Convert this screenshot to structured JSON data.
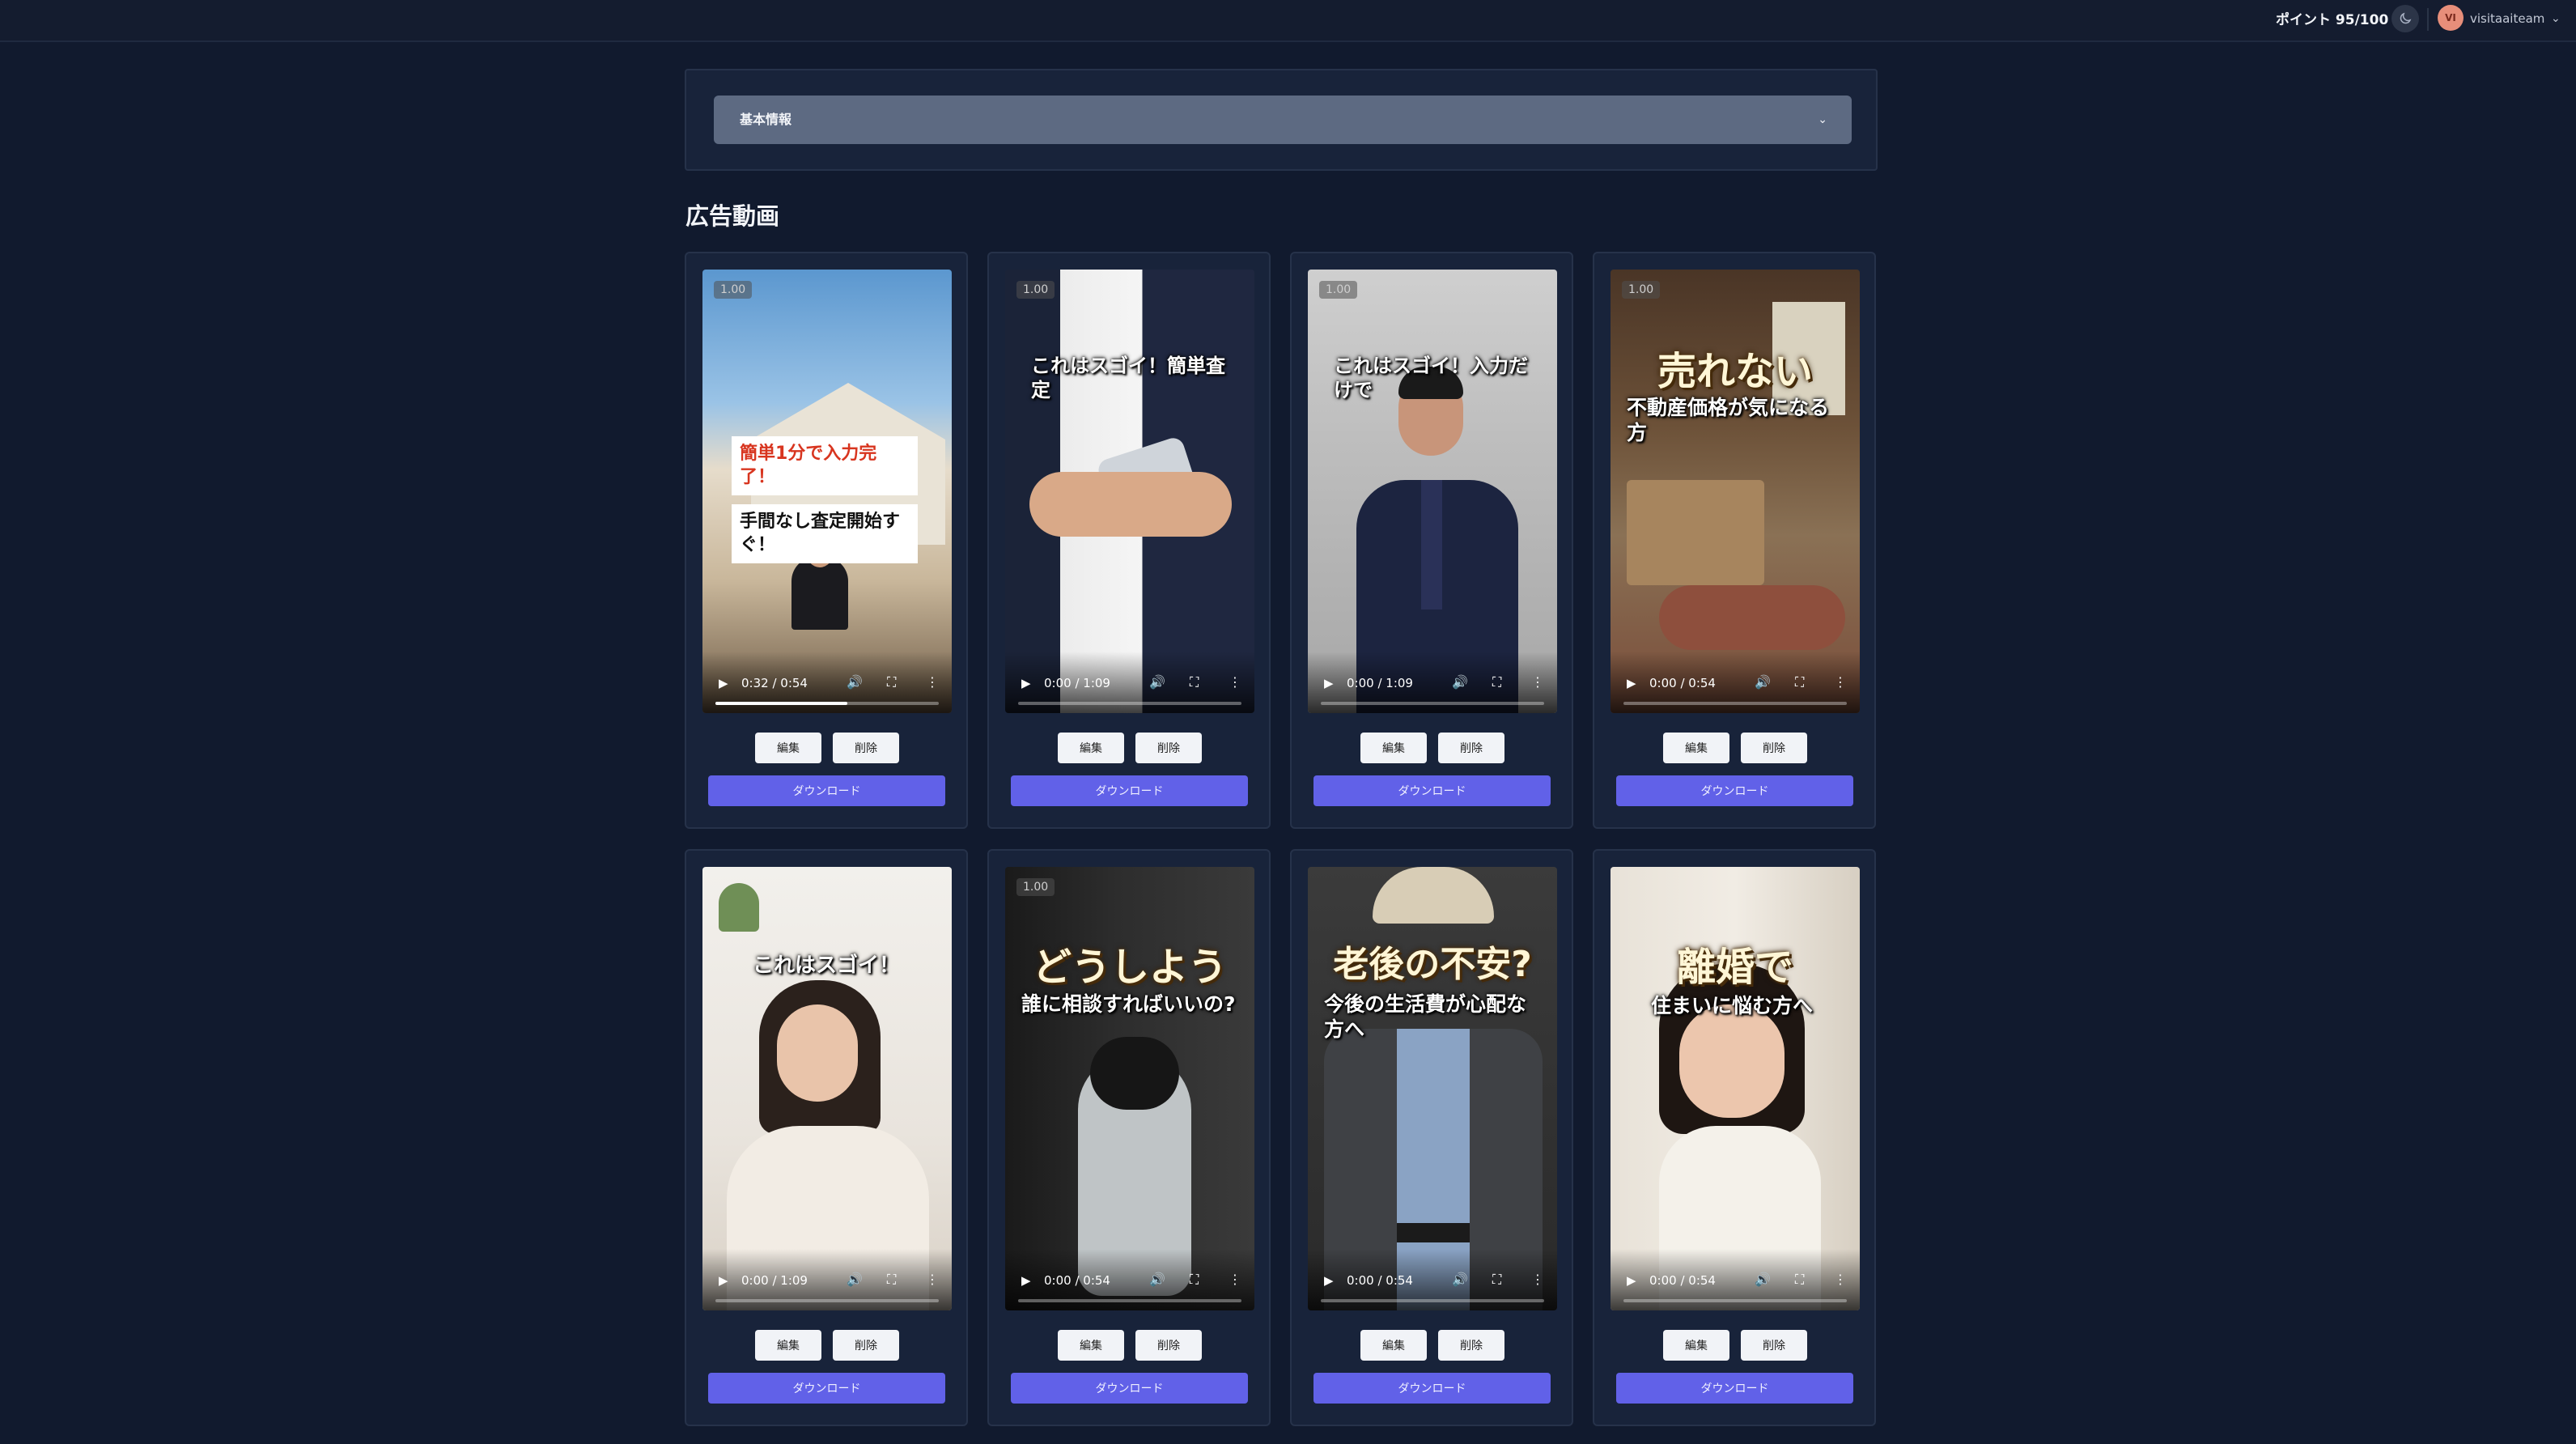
{
  "header": {
    "points": "ポイント 95/100",
    "avatar_initials": "VI",
    "username": "visitaaiteam",
    "theme_icon": "moon-icon",
    "caret_icon": "chevron-down-icon"
  },
  "basic_info": {
    "label": "基本情報",
    "caret_icon": "chevron-down-icon"
  },
  "section": {
    "title": "広告動画"
  },
  "colors": {
    "background": "#111a2e",
    "card": "#18233a",
    "accordion": "#5d6a82",
    "download": "#6161e8",
    "red_caption": "#d8351f"
  },
  "videos": [
    {
      "badge": "1.00",
      "time": "0:32 / 0:54",
      "progress": 0.59,
      "caption_red": "簡単1分で入力完了！",
      "caption_black": "手間なし査定開始すぐ！",
      "edit": "編集",
      "delete": "削除",
      "download": "ダウンロード"
    },
    {
      "badge": "1.00",
      "time": "0:00 / 1:09",
      "progress": 0,
      "caption": "これはスゴイ！簡単査定",
      "edit": "編集",
      "delete": "削除",
      "download": "ダウンロード"
    },
    {
      "badge": "1.00",
      "time": "0:00 / 1:09",
      "progress": 0,
      "caption": "これはスゴイ！入力だけで",
      "edit": "編集",
      "delete": "削除",
      "download": "ダウンロード"
    },
    {
      "badge": "1.00",
      "time": "0:00 / 0:54",
      "progress": 0,
      "caption_big": "売れない",
      "caption": "不動産価格が気になる方",
      "edit": "編集",
      "delete": "削除",
      "download": "ダウンロード"
    },
    {
      "badge": "",
      "time": "0:00 / 1:09",
      "progress": 0,
      "caption": "これはスゴイ！",
      "edit": "編集",
      "delete": "削除",
      "download": "ダウンロード"
    },
    {
      "badge": "1.00",
      "time": "0:00 / 0:54",
      "progress": 0,
      "caption_big": "どうしよう",
      "caption": "誰に相談すればいいの?",
      "edit": "編集",
      "delete": "削除",
      "download": "ダウンロード"
    },
    {
      "badge": "",
      "time": "0:00 / 0:54",
      "progress": 0,
      "caption_big": "老後の不安?",
      "caption": "今後の生活費が心配な方へ",
      "edit": "編集",
      "delete": "削除",
      "download": "ダウンロード"
    },
    {
      "badge": "",
      "time": "0:00 / 0:54",
      "progress": 0,
      "caption_big": "離婚で",
      "caption": "住まいに悩む方へ",
      "edit": "編集",
      "delete": "削除",
      "download": "ダウンロード"
    }
  ]
}
